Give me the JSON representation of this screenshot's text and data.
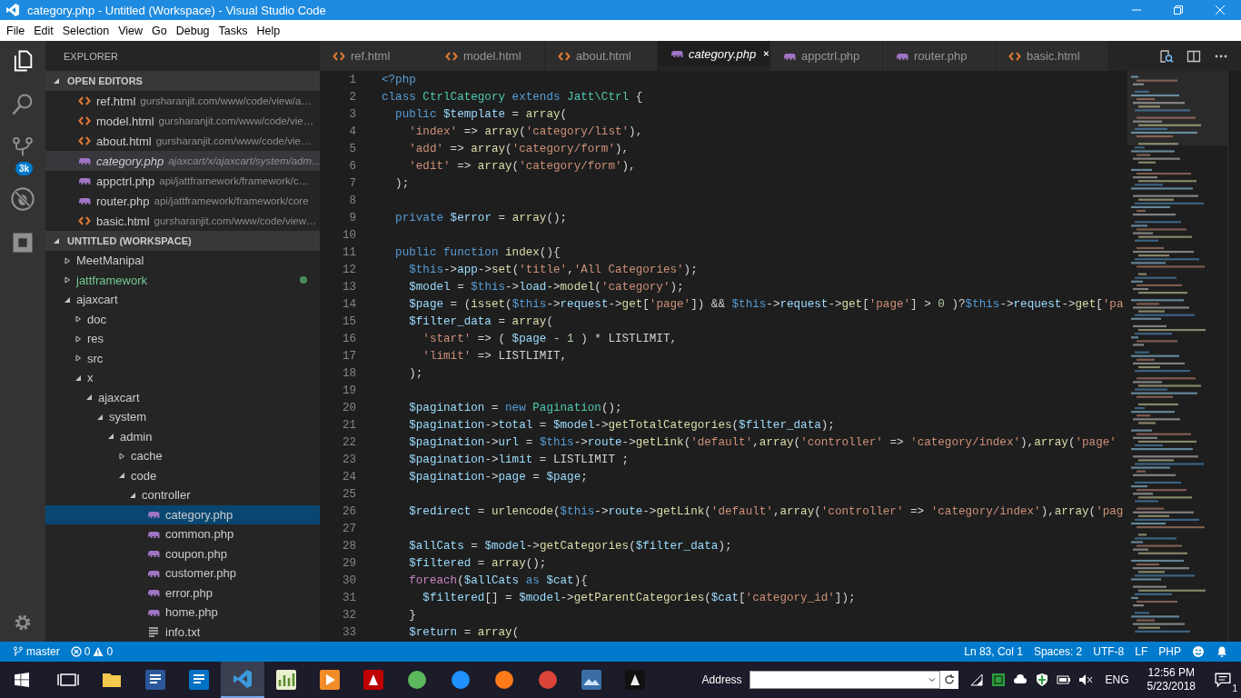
{
  "window": {
    "title": "category.php - Untitled (Workspace) - Visual Studio Code"
  },
  "menu": [
    "File",
    "Edit",
    "Selection",
    "View",
    "Go",
    "Debug",
    "Tasks",
    "Help"
  ],
  "activity": {
    "source_control_badge": "3k"
  },
  "sidebar": {
    "title": "EXPLORER",
    "open_editors_title": "OPEN EDITORS",
    "workspace_title": "UNTITLED (WORKSPACE)"
  },
  "open_editors": [
    {
      "kind": "html",
      "name": "ref.html",
      "path": "gursharanjit.com/www/code/view/a…",
      "selected": false,
      "preview": false
    },
    {
      "kind": "html",
      "name": "model.html",
      "path": "gursharanjit.com/www/code/vie…",
      "selected": false,
      "preview": false
    },
    {
      "kind": "html",
      "name": "about.html",
      "path": "gursharanjit.com/www/code/vie…",
      "selected": false,
      "preview": false
    },
    {
      "kind": "php",
      "name": "category.php",
      "path": "ajaxcart/x/ajaxcart/system/adm…",
      "selected": true,
      "preview": true
    },
    {
      "kind": "php",
      "name": "appctrl.php",
      "path": "api/jattframework/framework/c…",
      "selected": false,
      "preview": false
    },
    {
      "kind": "php",
      "name": "router.php",
      "path": "api/jattframework/framework/core",
      "selected": false,
      "preview": false
    },
    {
      "kind": "html",
      "name": "basic.html",
      "path": "gursharanjit.com/www/code/view…",
      "selected": false,
      "preview": false
    }
  ],
  "workspace": {
    "tree": [
      {
        "kind": "folder",
        "name": "MeetManipal",
        "expanded": false,
        "modified": false,
        "selected": false
      },
      {
        "kind": "folder",
        "name": "jattframework",
        "expanded": false,
        "modified": true,
        "selected": false
      },
      {
        "kind": "folder",
        "name": "ajaxcart",
        "expanded": true,
        "modified": false,
        "selected": false,
        "children": [
          {
            "kind": "folder",
            "name": "doc",
            "expanded": false,
            "modified": false,
            "selected": false
          },
          {
            "kind": "folder",
            "name": "res",
            "expanded": false,
            "modified": false,
            "selected": false
          },
          {
            "kind": "folder",
            "name": "src",
            "expanded": false,
            "modified": false,
            "selected": false
          },
          {
            "kind": "folder",
            "name": "x",
            "expanded": true,
            "modified": false,
            "selected": false,
            "children": [
              {
                "kind": "folder",
                "name": "ajaxcart",
                "expanded": true,
                "modified": false,
                "selected": false,
                "children": [
                  {
                    "kind": "folder",
                    "name": "system",
                    "expanded": true,
                    "modified": false,
                    "selected": false,
                    "children": [
                      {
                        "kind": "folder",
                        "name": "admin",
                        "expanded": true,
                        "modified": false,
                        "selected": false,
                        "children": [
                          {
                            "kind": "folder",
                            "name": "cache",
                            "expanded": false,
                            "modified": false,
                            "selected": false
                          },
                          {
                            "kind": "folder",
                            "name": "code",
                            "expanded": true,
                            "modified": false,
                            "selected": false,
                            "children": [
                              {
                                "kind": "folder",
                                "name": "controller",
                                "expanded": true,
                                "modified": false,
                                "selected": false,
                                "children": [
                                  {
                                    "kind": "php",
                                    "name": "category.php",
                                    "modified": false,
                                    "selected": true
                                  },
                                  {
                                    "kind": "php",
                                    "name": "common.php",
                                    "modified": false,
                                    "selected": false
                                  },
                                  {
                                    "kind": "php",
                                    "name": "coupon.php",
                                    "modified": false,
                                    "selected": false
                                  },
                                  {
                                    "kind": "php",
                                    "name": "customer.php",
                                    "modified": false,
                                    "selected": false
                                  },
                                  {
                                    "kind": "php",
                                    "name": "error.php",
                                    "modified": false,
                                    "selected": false
                                  },
                                  {
                                    "kind": "php",
                                    "name": "home.php",
                                    "modified": false,
                                    "selected": false
                                  },
                                  {
                                    "kind": "text",
                                    "name": "info.txt",
                                    "modified": false,
                                    "selected": false
                                  }
                                ]
                              }
                            ]
                          }
                        ]
                      }
                    ]
                  }
                ]
              }
            ]
          }
        ]
      }
    ]
  },
  "tabs": [
    {
      "kind": "html",
      "label": "ref.html",
      "selected": false,
      "preview": false
    },
    {
      "kind": "html",
      "label": "model.html",
      "selected": false,
      "preview": false
    },
    {
      "kind": "html",
      "label": "about.html",
      "selected": false,
      "preview": false
    },
    {
      "kind": "php",
      "label": "category.php",
      "selected": true,
      "preview": true
    },
    {
      "kind": "php",
      "label": "appctrl.php",
      "selected": false,
      "preview": false
    },
    {
      "kind": "php",
      "label": "router.php",
      "selected": false,
      "preview": false
    },
    {
      "kind": "html",
      "label": "basic.html",
      "selected": false,
      "preview": false
    }
  ],
  "code": [
    {
      "n": "1",
      "tokens": [
        {
          "kind": "kw",
          "text": "<?php"
        }
      ]
    },
    {
      "n": "2",
      "tokens": [
        {
          "kind": "kw",
          "text": "class"
        },
        {
          "kind": "type",
          "text": " CtrlCategory"
        },
        {
          "kind": "kw",
          "text": " extends"
        },
        {
          "kind": "type",
          "text": " Jatt\\Ctrl"
        },
        {
          "kind": "p",
          "text": " {"
        }
      ]
    },
    {
      "n": "3",
      "tokens": [
        {
          "kind": "kw",
          "text": "  public"
        },
        {
          "kind": "var",
          "text": " $template"
        },
        {
          "kind": "p",
          "text": " = "
        },
        {
          "kind": "fn",
          "text": "array"
        },
        {
          "kind": "p",
          "text": "("
        }
      ]
    },
    {
      "n": "4",
      "tokens": [
        {
          "kind": "str",
          "text": "    'index'"
        },
        {
          "kind": "p",
          "text": " => "
        },
        {
          "kind": "fn",
          "text": "array"
        },
        {
          "kind": "p",
          "text": "("
        },
        {
          "kind": "str",
          "text": "'category/list'"
        },
        {
          "kind": "p",
          "text": "),"
        }
      ]
    },
    {
      "n": "5",
      "tokens": [
        {
          "kind": "str",
          "text": "    'add'"
        },
        {
          "kind": "p",
          "text": " => "
        },
        {
          "kind": "fn",
          "text": "array"
        },
        {
          "kind": "p",
          "text": "("
        },
        {
          "kind": "str",
          "text": "'category/form'"
        },
        {
          "kind": "p",
          "text": "),"
        }
      ]
    },
    {
      "n": "6",
      "tokens": [
        {
          "kind": "str",
          "text": "    'edit'"
        },
        {
          "kind": "p",
          "text": " => "
        },
        {
          "kind": "fn",
          "text": "array"
        },
        {
          "kind": "p",
          "text": "("
        },
        {
          "kind": "str",
          "text": "'category/form'"
        },
        {
          "kind": "p",
          "text": "),"
        }
      ]
    },
    {
      "n": "7",
      "tokens": [
        {
          "kind": "p",
          "text": "  );"
        }
      ]
    },
    {
      "n": "8"
    },
    {
      "n": "9",
      "tokens": [
        {
          "kind": "kw",
          "text": "  private"
        },
        {
          "kind": "var",
          "text": " $error"
        },
        {
          "kind": "p",
          "text": " = "
        },
        {
          "kind": "fn",
          "text": "array"
        },
        {
          "kind": "p",
          "text": "();"
        }
      ]
    },
    {
      "n": "10"
    },
    {
      "n": "11",
      "tokens": [
        {
          "kind": "kw",
          "text": "  public"
        },
        {
          "kind": "kw",
          "text": " function"
        },
        {
          "kind": "fn",
          "text": " index"
        },
        {
          "kind": "p",
          "text": "(){"
        }
      ]
    },
    {
      "n": "12",
      "tokens": [
        {
          "kind": "kw",
          "text": "    $this"
        },
        {
          "kind": "p",
          "text": "->"
        },
        {
          "kind": "var",
          "text": "app"
        },
        {
          "kind": "p",
          "text": "->"
        },
        {
          "kind": "fn",
          "text": "set"
        },
        {
          "kind": "p",
          "text": "("
        },
        {
          "kind": "str",
          "text": "'title'"
        },
        {
          "kind": "p",
          "text": ","
        },
        {
          "kind": "str",
          "text": "'All Categories'"
        },
        {
          "kind": "p",
          "text": ");"
        }
      ]
    },
    {
      "n": "13",
      "tokens": [
        {
          "kind": "var",
          "text": "    $model"
        },
        {
          "kind": "p",
          "text": " = "
        },
        {
          "kind": "kw",
          "text": "$this"
        },
        {
          "kind": "p",
          "text": "->"
        },
        {
          "kind": "var",
          "text": "load"
        },
        {
          "kind": "p",
          "text": "->"
        },
        {
          "kind": "fn",
          "text": "model"
        },
        {
          "kind": "p",
          "text": "("
        },
        {
          "kind": "str",
          "text": "'category'"
        },
        {
          "kind": "p",
          "text": ");"
        }
      ]
    },
    {
      "n": "14",
      "tokens": [
        {
          "kind": "var",
          "text": "    $page"
        },
        {
          "kind": "p",
          "text": " = ("
        },
        {
          "kind": "fn",
          "text": "isset"
        },
        {
          "kind": "p",
          "text": "("
        },
        {
          "kind": "kw",
          "text": "$this"
        },
        {
          "kind": "p",
          "text": "->"
        },
        {
          "kind": "var",
          "text": "request"
        },
        {
          "kind": "p",
          "text": "->"
        },
        {
          "kind": "fn",
          "text": "get"
        },
        {
          "kind": "p",
          "text": "["
        },
        {
          "kind": "str",
          "text": "'page'"
        },
        {
          "kind": "p",
          "text": "]) && "
        },
        {
          "kind": "kw",
          "text": "$this"
        },
        {
          "kind": "p",
          "text": "->"
        },
        {
          "kind": "var",
          "text": "request"
        },
        {
          "kind": "p",
          "text": "->"
        },
        {
          "kind": "fn",
          "text": "get"
        },
        {
          "kind": "p",
          "text": "["
        },
        {
          "kind": "str",
          "text": "'page'"
        },
        {
          "kind": "p",
          "text": "] > "
        },
        {
          "kind": "num",
          "text": "0"
        },
        {
          "kind": "p",
          "text": " )?"
        },
        {
          "kind": "kw",
          "text": "$this"
        },
        {
          "kind": "p",
          "text": "->"
        },
        {
          "kind": "var",
          "text": "request"
        },
        {
          "kind": "p",
          "text": "->"
        },
        {
          "kind": "fn",
          "text": "get"
        },
        {
          "kind": "p",
          "text": "["
        },
        {
          "kind": "str",
          "text": "'pa"
        }
      ]
    },
    {
      "n": "15",
      "tokens": [
        {
          "kind": "var",
          "text": "    $filter_data"
        },
        {
          "kind": "p",
          "text": " = "
        },
        {
          "kind": "fn",
          "text": "array"
        },
        {
          "kind": "p",
          "text": "("
        }
      ]
    },
    {
      "n": "16",
      "tokens": [
        {
          "kind": "str",
          "text": "      'start'"
        },
        {
          "kind": "p",
          "text": " => ( "
        },
        {
          "kind": "var",
          "text": "$page"
        },
        {
          "kind": "p",
          "text": " - "
        },
        {
          "kind": "num",
          "text": "1"
        },
        {
          "kind": "p",
          "text": " ) * LISTLIMIT,"
        }
      ]
    },
    {
      "n": "17",
      "tokens": [
        {
          "kind": "str",
          "text": "      'limit'"
        },
        {
          "kind": "p",
          "text": " => LISTLIMIT,"
        }
      ]
    },
    {
      "n": "18",
      "tokens": [
        {
          "kind": "p",
          "text": "    );"
        }
      ]
    },
    {
      "n": "19"
    },
    {
      "n": "20",
      "tokens": [
        {
          "kind": "var",
          "text": "    $pagination"
        },
        {
          "kind": "p",
          "text": " = "
        },
        {
          "kind": "kw",
          "text": "new"
        },
        {
          "kind": "type",
          "text": " Pagination"
        },
        {
          "kind": "p",
          "text": "();"
        }
      ]
    },
    {
      "n": "21",
      "tokens": [
        {
          "kind": "var",
          "text": "    $pagination"
        },
        {
          "kind": "p",
          "text": "->"
        },
        {
          "kind": "var",
          "text": "total"
        },
        {
          "kind": "p",
          "text": " = "
        },
        {
          "kind": "var",
          "text": "$model"
        },
        {
          "kind": "p",
          "text": "->"
        },
        {
          "kind": "fn",
          "text": "getTotalCategories"
        },
        {
          "kind": "p",
          "text": "("
        },
        {
          "kind": "var",
          "text": "$filter_data"
        },
        {
          "kind": "p",
          "text": ");"
        }
      ]
    },
    {
      "n": "22",
      "tokens": [
        {
          "kind": "var",
          "text": "    $pagination"
        },
        {
          "kind": "p",
          "text": "->"
        },
        {
          "kind": "var",
          "text": "url"
        },
        {
          "kind": "p",
          "text": " = "
        },
        {
          "kind": "kw",
          "text": "$this"
        },
        {
          "kind": "p",
          "text": "->"
        },
        {
          "kind": "var",
          "text": "route"
        },
        {
          "kind": "p",
          "text": "->"
        },
        {
          "kind": "fn",
          "text": "getLink"
        },
        {
          "kind": "p",
          "text": "("
        },
        {
          "kind": "str",
          "text": "'default'"
        },
        {
          "kind": "p",
          "text": ","
        },
        {
          "kind": "fn",
          "text": "array"
        },
        {
          "kind": "p",
          "text": "("
        },
        {
          "kind": "str",
          "text": "'controller'"
        },
        {
          "kind": "p",
          "text": " => "
        },
        {
          "kind": "str",
          "text": "'category/index'"
        },
        {
          "kind": "p",
          "text": "),"
        },
        {
          "kind": "fn",
          "text": "array"
        },
        {
          "kind": "p",
          "text": "("
        },
        {
          "kind": "str",
          "text": "'page'"
        }
      ]
    },
    {
      "n": "23",
      "tokens": [
        {
          "kind": "var",
          "text": "    $pagination"
        },
        {
          "kind": "p",
          "text": "->"
        },
        {
          "kind": "var",
          "text": "limit"
        },
        {
          "kind": "p",
          "text": " = LISTLIMIT ;"
        }
      ]
    },
    {
      "n": "24",
      "tokens": [
        {
          "kind": "var",
          "text": "    $pagination"
        },
        {
          "kind": "p",
          "text": "->"
        },
        {
          "kind": "var",
          "text": "page"
        },
        {
          "kind": "p",
          "text": " = "
        },
        {
          "kind": "var",
          "text": "$page"
        },
        {
          "kind": "p",
          "text": ";"
        }
      ]
    },
    {
      "n": "25"
    },
    {
      "n": "26",
      "tokens": [
        {
          "kind": "var",
          "text": "    $redirect"
        },
        {
          "kind": "p",
          "text": " = "
        },
        {
          "kind": "fn",
          "text": "urlencode"
        },
        {
          "kind": "p",
          "text": "("
        },
        {
          "kind": "kw",
          "text": "$this"
        },
        {
          "kind": "p",
          "text": "->"
        },
        {
          "kind": "var",
          "text": "route"
        },
        {
          "kind": "p",
          "text": "->"
        },
        {
          "kind": "fn",
          "text": "getLink"
        },
        {
          "kind": "p",
          "text": "("
        },
        {
          "kind": "str",
          "text": "'default'"
        },
        {
          "kind": "p",
          "text": ","
        },
        {
          "kind": "fn",
          "text": "array"
        },
        {
          "kind": "p",
          "text": "("
        },
        {
          "kind": "str",
          "text": "'controller'"
        },
        {
          "kind": "p",
          "text": " => "
        },
        {
          "kind": "str",
          "text": "'category/index'"
        },
        {
          "kind": "p",
          "text": "),"
        },
        {
          "kind": "fn",
          "text": "array"
        },
        {
          "kind": "p",
          "text": "("
        },
        {
          "kind": "str",
          "text": "'pag"
        }
      ]
    },
    {
      "n": "27"
    },
    {
      "n": "28",
      "tokens": [
        {
          "kind": "var",
          "text": "    $allCats"
        },
        {
          "kind": "p",
          "text": " = "
        },
        {
          "kind": "var",
          "text": "$model"
        },
        {
          "kind": "p",
          "text": "->"
        },
        {
          "kind": "fn",
          "text": "getCategories"
        },
        {
          "kind": "p",
          "text": "("
        },
        {
          "kind": "var",
          "text": "$filter_data"
        },
        {
          "kind": "p",
          "text": ");"
        }
      ]
    },
    {
      "n": "29",
      "tokens": [
        {
          "kind": "var",
          "text": "    $filtered"
        },
        {
          "kind": "p",
          "text": " = "
        },
        {
          "kind": "fn",
          "text": "array"
        },
        {
          "kind": "p",
          "text": "();"
        }
      ]
    },
    {
      "n": "30",
      "tokens": [
        {
          "kind": "ctl",
          "text": "    foreach"
        },
        {
          "kind": "p",
          "text": "("
        },
        {
          "kind": "var",
          "text": "$allCats"
        },
        {
          "kind": "kw",
          "text": " as"
        },
        {
          "kind": "var",
          "text": " $cat"
        },
        {
          "kind": "p",
          "text": "){"
        }
      ]
    },
    {
      "n": "31",
      "tokens": [
        {
          "kind": "var",
          "text": "      $filtered"
        },
        {
          "kind": "p",
          "text": "[] = "
        },
        {
          "kind": "var",
          "text": "$model"
        },
        {
          "kind": "p",
          "text": "->"
        },
        {
          "kind": "fn",
          "text": "getParentCategories"
        },
        {
          "kind": "p",
          "text": "("
        },
        {
          "kind": "var",
          "text": "$cat"
        },
        {
          "kind": "p",
          "text": "["
        },
        {
          "kind": "str",
          "text": "'category_id'"
        },
        {
          "kind": "p",
          "text": "]);"
        }
      ]
    },
    {
      "n": "32",
      "tokens": [
        {
          "kind": "p",
          "text": "    }"
        }
      ]
    },
    {
      "n": "33",
      "tokens": [
        {
          "kind": "var",
          "text": "    $return"
        },
        {
          "kind": "p",
          "text": " = "
        },
        {
          "kind": "fn",
          "text": "array"
        },
        {
          "kind": "p",
          "text": "("
        }
      ]
    }
  ],
  "status_bar": {
    "branch": "master",
    "errors": "0",
    "warnings": "0",
    "position": "Ln 83, Col 1",
    "indent": "Spaces: 2",
    "encoding": "UTF-8",
    "eol": "LF",
    "language": "PHP"
  },
  "taskbar": {
    "apps": [
      {
        "kind": "taskview",
        "selected": false
      },
      {
        "kind": "explorer",
        "selected": false
      },
      {
        "kind": "word",
        "selected": false
      },
      {
        "kind": "outlook",
        "selected": false
      },
      {
        "kind": "vscode",
        "selected": true
      },
      {
        "kind": "chart",
        "selected": false
      },
      {
        "kind": "media",
        "selected": false
      },
      {
        "kind": "ftp",
        "selected": false
      },
      {
        "kind": "globe",
        "selected": false
      },
      {
        "kind": "edge",
        "selected": false
      },
      {
        "kind": "firefox",
        "selected": false
      },
      {
        "kind": "chrome",
        "selected": false
      },
      {
        "kind": "photos",
        "selected": false
      },
      {
        "kind": "game",
        "selected": false
      }
    ],
    "address_label": "Address",
    "language": "ENG",
    "time": "12:56 PM",
    "date": "5/23/2018",
    "notifications": "1"
  }
}
